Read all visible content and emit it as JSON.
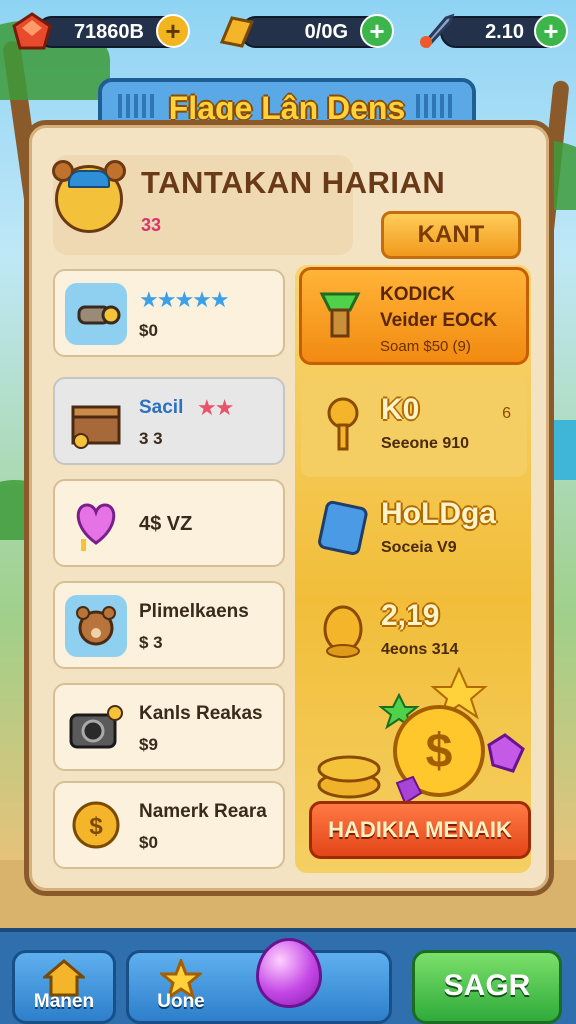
{
  "resources": [
    {
      "icon": "ruby-gem-icon",
      "value": "71860B"
    },
    {
      "icon": "gold-bar-icon",
      "value": "0/0G"
    },
    {
      "icon": "rocket-icon",
      "value": "2.10"
    }
  ],
  "title": "Flage Lân Dens",
  "daily": {
    "title": "TANTAKAN HARIAN",
    "subtitle": "33",
    "button": "KANT"
  },
  "tasks": [
    {
      "icon": "flashlight-icon",
      "name": "",
      "stars": "★★★★★",
      "reward": "$0"
    },
    {
      "icon": "crate-icon",
      "name": "Sacil",
      "stars": "★★",
      "reward": "3 3"
    },
    {
      "icon": "heart-lollipop-icon",
      "name": "4$ VZ",
      "stars": "",
      "reward": ""
    },
    {
      "icon": "bear-face-icon",
      "name": "Plimelkaens",
      "stars": "",
      "reward": "$ 3"
    },
    {
      "icon": "camera-icon",
      "name": "Kanls Reakas",
      "stars": "",
      "reward": "$9"
    },
    {
      "icon": "coin-icon",
      "name": "Namerk Reara",
      "stars": "",
      "reward": "$0"
    }
  ],
  "featured": {
    "icon": "green-gem-icon",
    "title": "KODICK",
    "line": "Veider EOCK",
    "sub": "Soam $50 (9)"
  },
  "rewards": [
    {
      "icon": "golden-key-icon",
      "value": "K0",
      "sub": "Seeone 910",
      "extra": "6"
    },
    {
      "icon": "blue-tablet-icon",
      "value": "HoLDga",
      "sub": "Soceia V9",
      "extra": ""
    },
    {
      "icon": "gold-nugget-icon",
      "value": "2,19",
      "sub": "4eons 314",
      "extra": ""
    }
  ],
  "claim_button": "HADIKIA MENAIK",
  "nav": {
    "left": "Manen",
    "middle": "Uone",
    "right": "SAGR"
  }
}
